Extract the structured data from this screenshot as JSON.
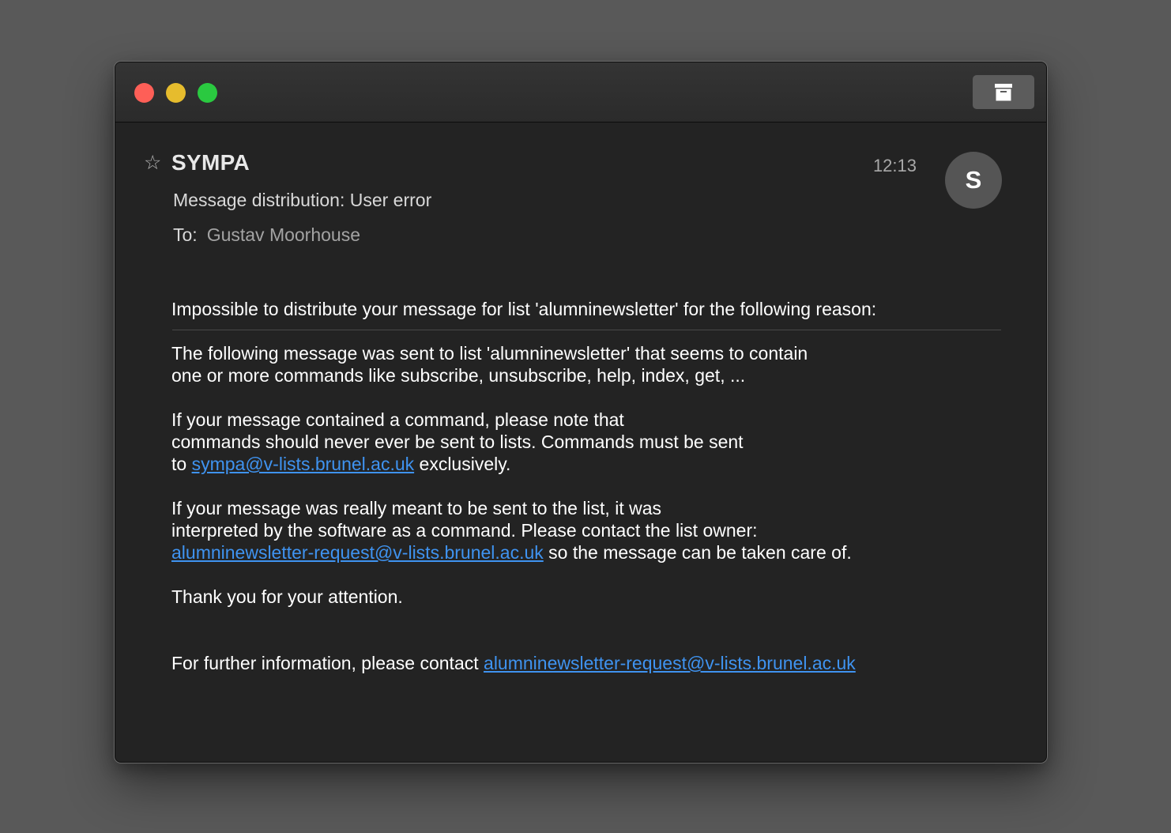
{
  "window": {
    "archive_icon": "archive-box-icon"
  },
  "message": {
    "star_glyph": "☆",
    "sender": "SYMPA",
    "time": "12:13",
    "avatar_letter": "S",
    "subject": "Message distribution: User error",
    "to_label": "To:",
    "to_name": "Gustav Moorhouse"
  },
  "body": {
    "p1": "Impossible to distribute your message for list 'alumninewsletter' for the following reason:",
    "p2_line1": "The following message was sent to list 'alumninewsletter' that seems to contain",
    "p2_line2": "one or more commands like subscribe, unsubscribe, help, index, get, ...",
    "p3_line1": "If your message contained a command, please note that",
    "p3_line2": "commands should never ever be sent to lists. Commands must be sent",
    "p3_line3_prefix": "to ",
    "p3_link": "sympa@v-lists.brunel.ac.uk",
    "p3_line3_suffix": " exclusively.",
    "p4_line1": "If your message was really meant to be sent to the list, it was",
    "p4_line2": "interpreted by the software as a command. Please contact the list owner:",
    "p4_link": "alumninewsletter-request@v-lists.brunel.ac.uk",
    "p4_line3_suffix": " so the message can be taken care of.",
    "p5": "Thank you for your attention.",
    "p6_prefix": "For further information, please contact ",
    "p6_link": "alumninewsletter-request@v-lists.brunel.ac.uk"
  },
  "colors": {
    "background": "#595959",
    "window": "#232323",
    "link": "#3f93f0",
    "close": "#fe5f57",
    "minimize": "#e6bc2d",
    "maximize": "#2ac940"
  }
}
